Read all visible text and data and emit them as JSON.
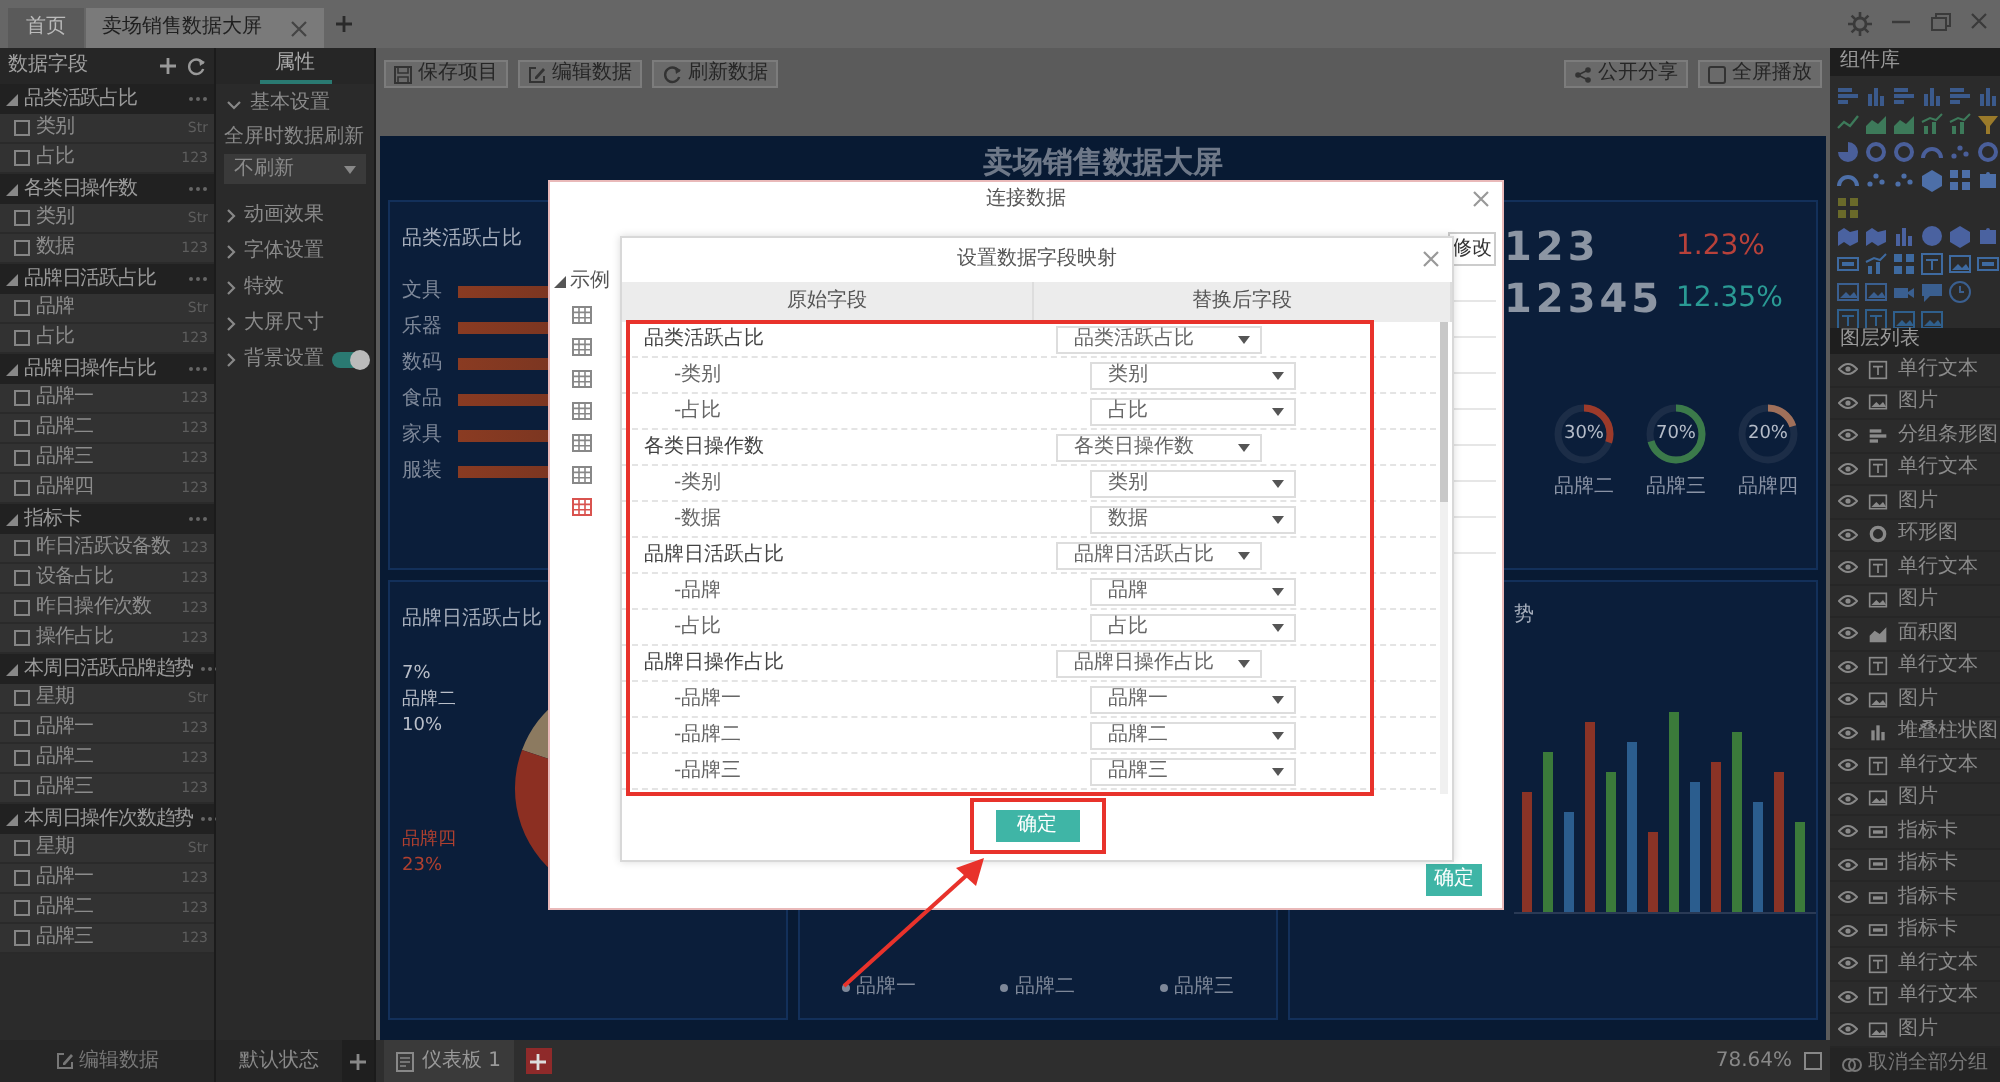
{
  "tabs": [
    {
      "label": "首页",
      "kind": "home",
      "selected": false,
      "closable": false
    },
    {
      "label": "卖场销售数据大屏",
      "kind": "project",
      "selected": true,
      "closable": true
    }
  ],
  "data_fields": {
    "title": "数据字段",
    "groups": [
      {
        "name": "品类活跃占比",
        "children": [
          {
            "name": "类别",
            "type": "Str",
            "checked": false
          },
          {
            "name": "占比",
            "type": "123",
            "checked": false
          }
        ]
      },
      {
        "name": "各类日操作数",
        "children": [
          {
            "name": "类别",
            "type": "Str",
            "checked": false
          },
          {
            "name": "数据",
            "type": "123",
            "checked": false
          }
        ]
      },
      {
        "name": "品牌日活跃占比",
        "children": [
          {
            "name": "品牌",
            "type": "Str",
            "checked": false
          },
          {
            "name": "占比",
            "type": "123",
            "checked": false
          }
        ]
      },
      {
        "name": "品牌日操作占比",
        "children": [
          {
            "name": "品牌一",
            "type": "123",
            "checked": false
          },
          {
            "name": "品牌二",
            "type": "123",
            "checked": false
          },
          {
            "name": "品牌三",
            "type": "123",
            "checked": false
          },
          {
            "name": "品牌四",
            "type": "123",
            "checked": false
          }
        ]
      },
      {
        "name": "指标卡",
        "children": [
          {
            "name": "昨日活跃设备数",
            "type": "123",
            "checked": false
          },
          {
            "name": "设备占比",
            "type": "123",
            "checked": false
          },
          {
            "name": "昨日操作次数",
            "type": "123",
            "checked": false
          },
          {
            "name": "操作占比",
            "type": "123",
            "checked": false
          }
        ]
      },
      {
        "name": "本周日活跃品牌趋势",
        "children": [
          {
            "name": "星期",
            "type": "Str",
            "checked": false
          },
          {
            "name": "品牌一",
            "type": "123",
            "checked": false
          },
          {
            "name": "品牌二",
            "type": "123",
            "checked": false
          },
          {
            "name": "品牌三",
            "type": "123",
            "checked": false
          }
        ]
      },
      {
        "name": "本周日操作次数趋势",
        "children": [
          {
            "name": "星期",
            "type": "Str",
            "checked": false
          },
          {
            "name": "品牌一",
            "type": "123",
            "checked": false
          },
          {
            "name": "品牌二",
            "type": "123",
            "checked": false
          },
          {
            "name": "品牌三",
            "type": "123",
            "checked": false
          }
        ]
      }
    ],
    "footer": "编辑数据"
  },
  "properties": {
    "tabs": [
      {
        "label": "属性",
        "selected": true
      }
    ],
    "sections": [
      {
        "label": "基本设置",
        "expanded": true,
        "fields": [
          {
            "label": "全屏时数据刷新",
            "value": "不刷新"
          }
        ]
      },
      {
        "label": "动画效果",
        "expanded": false
      },
      {
        "label": "字体设置",
        "expanded": false
      },
      {
        "label": "特效",
        "expanded": false
      },
      {
        "label": "大屏尺寸",
        "expanded": false
      },
      {
        "label": "背景设置",
        "expanded": false,
        "switch_on": true
      }
    ],
    "footer": "默认状态"
  },
  "toolbar": {
    "left": [
      "保存项目",
      "编辑数据",
      "刷新数据"
    ],
    "right": [
      "公开分享",
      "全屏播放"
    ]
  },
  "dashboard": {
    "title": "卖场销售数据大屏",
    "category_card": {
      "title": "品类活跃占比",
      "categories": [
        "文具",
        "乐器",
        "数码",
        "食品",
        "家具",
        "服装"
      ]
    },
    "kpis": [
      {
        "value": "123",
        "change": "1.23%",
        "color": "#b8413a"
      },
      {
        "value": "12345",
        "change": "12.35%",
        "color": "#2a9a94"
      }
    ],
    "rings": [
      {
        "value": "30%",
        "label": "品牌二",
        "level": 0.3,
        "color": "#9c3a2a"
      },
      {
        "value": "70%",
        "label": "品牌三",
        "level": 0.7,
        "color": "#3b7a4a"
      },
      {
        "value": "20%",
        "label": "品牌四",
        "level": 0.2,
        "color": "#a0705a"
      }
    ],
    "brand_card": {
      "title": "品牌日活跃占比",
      "labels": [
        {
          "value": "7%",
          "color": "#b9bec8"
        },
        {
          "name": "品牌二",
          "value": "10%",
          "color": "#b9bec8"
        },
        {
          "name": "品牌四",
          "value": "23%",
          "color": "#b0402f"
        }
      ]
    },
    "legend": [
      "品牌一",
      "品牌二",
      "品牌三"
    ],
    "trend_card": {
      "title": "势"
    }
  },
  "bottom_bar": {
    "page_tab": "仪表板 1",
    "zoom": "78.64%"
  },
  "library": {
    "title": "组件库"
  },
  "layers": {
    "title": "图层列表",
    "items": [
      {
        "label": "单行文本",
        "kind": "text"
      },
      {
        "label": "图片",
        "kind": "image"
      },
      {
        "label": "分组条形图",
        "kind": "hbar"
      },
      {
        "label": "单行文本",
        "kind": "text"
      },
      {
        "label": "图片",
        "kind": "image"
      },
      {
        "label": "环形图",
        "kind": "ring"
      },
      {
        "label": "单行文本",
        "kind": "text"
      },
      {
        "label": "图片",
        "kind": "image"
      },
      {
        "label": "面积图",
        "kind": "area"
      },
      {
        "label": "单行文本",
        "kind": "text"
      },
      {
        "label": "图片",
        "kind": "image"
      },
      {
        "label": "堆叠柱状图",
        "kind": "bar"
      },
      {
        "label": "单行文本",
        "kind": "text"
      },
      {
        "label": "图片",
        "kind": "image"
      },
      {
        "label": "指标卡",
        "kind": "kpi"
      },
      {
        "label": "指标卡",
        "kind": "kpi"
      },
      {
        "label": "指标卡",
        "kind": "kpi"
      },
      {
        "label": "指标卡",
        "kind": "kpi"
      },
      {
        "label": "单行文本",
        "kind": "text"
      },
      {
        "label": "单行文本",
        "kind": "text"
      },
      {
        "label": "图片",
        "kind": "image"
      }
    ],
    "footer": "取消全部分组"
  },
  "dialog": {
    "title": "连接数据",
    "sample_label": "示例",
    "tables": [
      {
        "selected": false
      },
      {
        "selected": false
      },
      {
        "selected": false
      },
      {
        "selected": false
      },
      {
        "selected": false
      },
      {
        "selected": false
      },
      {
        "selected": true
      }
    ],
    "edit_button": "修改",
    "confirm": "确定",
    "mapping": {
      "title": "设置数据字段映射",
      "columns": [
        "原始字段",
        "替换后字段"
      ],
      "rows": [
        {
          "field": "品类活跃占比",
          "value": "品类活跃占比",
          "children": [
            {
              "field": "-类别",
              "value": "类别"
            },
            {
              "field": "-占比",
              "value": "占比"
            }
          ]
        },
        {
          "field": "各类日操作数",
          "value": "各类日操作数",
          "children": [
            {
              "field": "-类别",
              "value": "类别"
            },
            {
              "field": "-数据",
              "value": "数据"
            }
          ]
        },
        {
          "field": "品牌日活跃占比",
          "value": "品牌日活跃占比",
          "children": [
            {
              "field": "-品牌",
              "value": "品牌"
            },
            {
              "field": "-占比",
              "value": "占比"
            }
          ]
        },
        {
          "field": "品牌日操作占比",
          "value": "品牌日操作占比",
          "children": [
            {
              "field": "-品牌一",
              "value": "品牌一"
            },
            {
              "field": "-品牌二",
              "value": "品牌二"
            },
            {
              "field": "-品牌三",
              "value": "品牌三"
            }
          ]
        }
      ],
      "confirm": "确定"
    }
  }
}
